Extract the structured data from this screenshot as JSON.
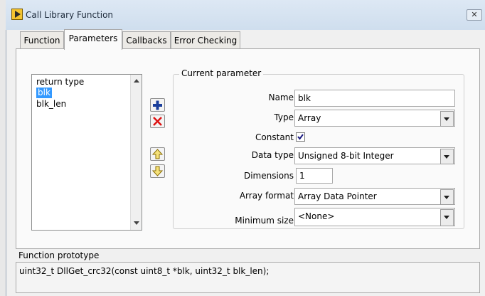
{
  "window": {
    "title": "Call Library Function",
    "close_label": "✕"
  },
  "tabs": [
    {
      "label": "Function"
    },
    {
      "label": "Parameters"
    },
    {
      "label": "Callbacks"
    },
    {
      "label": "Error Checking"
    }
  ],
  "active_tab": "Parameters",
  "param_list": [
    "return type",
    "blk",
    "blk_len"
  ],
  "selected_param": "blk",
  "current_parameter": {
    "group_title": "Current parameter",
    "name_label": "Name",
    "name_value": "blk",
    "type_label": "Type",
    "type_value": "Array",
    "constant_label": "Constant",
    "constant_checked": true,
    "data_type_label": "Data type",
    "data_type_value": "Unsigned 8-bit Integer",
    "dimensions_label": "Dimensions",
    "dimensions_value": "1",
    "array_format_label": "Array format",
    "array_format_value": "Array Data Pointer",
    "min_size_label": "Minimum size",
    "min_size_value": "<None>"
  },
  "prototype": {
    "label": "Function prototype",
    "text": "uint32_t DllGet_crc32(const uint8_t *blk, uint32_t blk_len);"
  }
}
